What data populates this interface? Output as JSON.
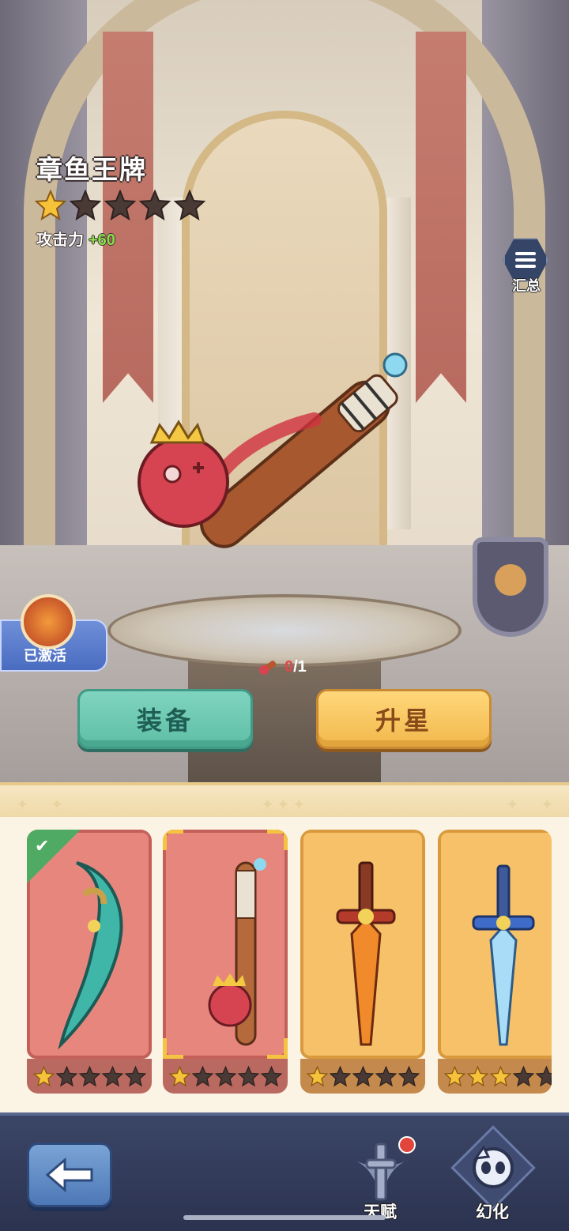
{
  "weapon": {
    "name": "章鱼王牌",
    "star_count": 1,
    "max_stars": 5,
    "stat_label": "攻击力",
    "stat_bonus": "+60"
  },
  "summary_button": {
    "label": "汇总",
    "icon": "list-icon"
  },
  "activated_badge": {
    "label": "已激活",
    "icon": "octopus-emblem-icon"
  },
  "fragment": {
    "have": "0",
    "sep": "/1"
  },
  "actions": {
    "equip_label": "装备",
    "star_up_label": "升星"
  },
  "cards": [
    {
      "name": "teal-scythe",
      "rarity": "red",
      "stars": 1,
      "equipped": true,
      "selected": false
    },
    {
      "name": "octopus-bat",
      "rarity": "red",
      "stars": 1,
      "equipped": false,
      "selected": true
    },
    {
      "name": "flame-sword",
      "rarity": "gold",
      "stars": 1,
      "equipped": false,
      "selected": false
    },
    {
      "name": "ice-sword",
      "rarity": "gold",
      "stars": 3,
      "equipped": false,
      "selected": false
    }
  ],
  "nav": {
    "back_icon": "arrow-left-icon",
    "talent_label": "天赋",
    "illusion_label": "幻化",
    "talent_has_notification": true
  },
  "colors": {
    "equip_button": "#6fc9b2",
    "star_up_button": "#f6c65a",
    "stat_bonus": "#8be04a",
    "red_card": "#e7867d",
    "gold_card": "#f6c169"
  }
}
